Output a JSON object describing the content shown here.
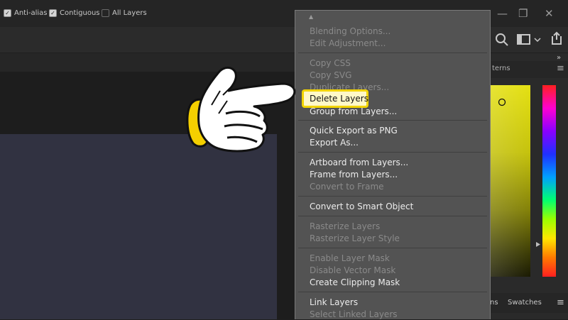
{
  "options": {
    "anti_alias": {
      "label": "Anti-alias",
      "checked": true
    },
    "contiguous": {
      "label": "Contiguous",
      "checked": true
    },
    "all_layers": {
      "label": "All Layers",
      "checked": false
    }
  },
  "panels": {
    "top_tab_partial": "terns",
    "bottom_tabs": [
      "ns",
      "Swatches"
    ],
    "collapse_glyph": "»",
    "menu_glyph": "≡"
  },
  "window_controls": {
    "minimize": "—",
    "restore": "❐",
    "close": "✕"
  },
  "context_menu": {
    "scroll_up": "▲",
    "groups": [
      [
        {
          "label": "Blending Options...",
          "enabled": false
        },
        {
          "label": "Edit Adjustment...",
          "enabled": false
        }
      ],
      [
        {
          "label": "Copy CSS",
          "enabled": false
        },
        {
          "label": "Copy SVG",
          "enabled": false
        },
        {
          "label": "Duplicate Layers...",
          "enabled": false
        },
        {
          "label": "Delete Layers",
          "enabled": true,
          "highlighted": true
        },
        {
          "label": "Group from Layers...",
          "enabled": true
        }
      ],
      [
        {
          "label": "Quick Export as PNG",
          "enabled": true
        },
        {
          "label": "Export As...",
          "enabled": true
        }
      ],
      [
        {
          "label": "Artboard from Layers...",
          "enabled": true
        },
        {
          "label": "Frame from Layers...",
          "enabled": true
        },
        {
          "label": "Convert to Frame",
          "enabled": false
        }
      ],
      [
        {
          "label": "Convert to Smart Object",
          "enabled": true
        }
      ],
      [
        {
          "label": "Rasterize Layers",
          "enabled": false
        },
        {
          "label": "Rasterize Layer Style",
          "enabled": false
        }
      ],
      [
        {
          "label": "Enable Layer Mask",
          "enabled": false
        },
        {
          "label": "Disable Vector Mask",
          "enabled": false
        },
        {
          "label": "Create Clipping Mask",
          "enabled": true
        }
      ],
      [
        {
          "label": "Link Layers",
          "enabled": true
        },
        {
          "label": "Select Linked Layers",
          "enabled": false
        }
      ]
    ]
  },
  "colors": {
    "highlight_border": "#f2d400",
    "menu_bg": "#535353",
    "canvas": "#313241"
  }
}
